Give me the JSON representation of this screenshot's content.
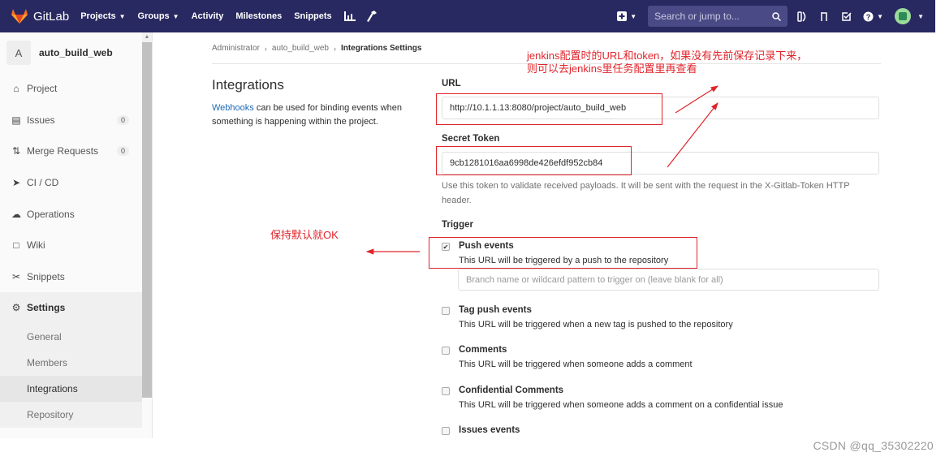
{
  "nav": {
    "brand": "GitLab",
    "items": [
      "Projects",
      "Groups",
      "Activity",
      "Milestones",
      "Snippets"
    ],
    "search_placeholder": "Search or jump to..."
  },
  "sidebar": {
    "project_initial": "A",
    "project_name": "auto_build_web",
    "items": [
      {
        "label": "Project",
        "icon": "home-icon"
      },
      {
        "label": "Issues",
        "icon": "issues-icon",
        "badge": "0"
      },
      {
        "label": "Merge Requests",
        "icon": "merge-request-icon",
        "badge": "0"
      },
      {
        "label": "CI / CD",
        "icon": "rocket-icon"
      },
      {
        "label": "Operations",
        "icon": "cloud-gear-icon"
      },
      {
        "label": "Wiki",
        "icon": "book-icon"
      },
      {
        "label": "Snippets",
        "icon": "scissors-icon"
      },
      {
        "label": "Settings",
        "icon": "settings-icon"
      }
    ],
    "settings_sub": [
      "General",
      "Members",
      "Integrations",
      "Repository"
    ]
  },
  "breadcrumb": {
    "items": [
      "Administrator",
      "auto_build_web",
      "Integrations Settings"
    ]
  },
  "intro": {
    "title": "Integrations",
    "link": "Webhooks",
    "desc": " can be used for binding events when something is happening within the project."
  },
  "form": {
    "url_label": "URL",
    "url_value": "http://10.1.1.13:8080/project/auto_build_web",
    "token_label": "Secret Token",
    "token_value": "9cb1281016aa6998de426efdf952cb84",
    "token_help": "Use this token to validate received payloads. It will be sent with the request in the X-Gitlab-Token HTTP header.",
    "trigger_label": "Trigger",
    "branch_placeholder": "Branch name or wildcard pattern to trigger on (leave blank for all)",
    "triggers": [
      {
        "title": "Push events",
        "desc": "This URL will be triggered by a push to the repository",
        "checked": true
      },
      {
        "title": "Tag push events",
        "desc": "This URL will be triggered when a new tag is pushed to the repository",
        "checked": false
      },
      {
        "title": "Comments",
        "desc": "This URL will be triggered when someone adds a comment",
        "checked": false
      },
      {
        "title": "Confidential Comments",
        "desc": "This URL will be triggered when someone adds a comment on a confidential issue",
        "checked": false
      },
      {
        "title": "Issues events",
        "desc": "",
        "checked": false
      }
    ]
  },
  "annotations": {
    "note_top_line1": "jenkins配置时的URL和token，如果没有先前保存记录下来，",
    "note_top_line2": "则可以去jenkins里任务配置里再查看",
    "note_left": "保持默认就OK"
  },
  "watermark": "CSDN @qq_35302220",
  "colors": {
    "nav_bg": "#292961",
    "annotation_red": "#e0242b",
    "link_blue": "#1b69b6"
  }
}
